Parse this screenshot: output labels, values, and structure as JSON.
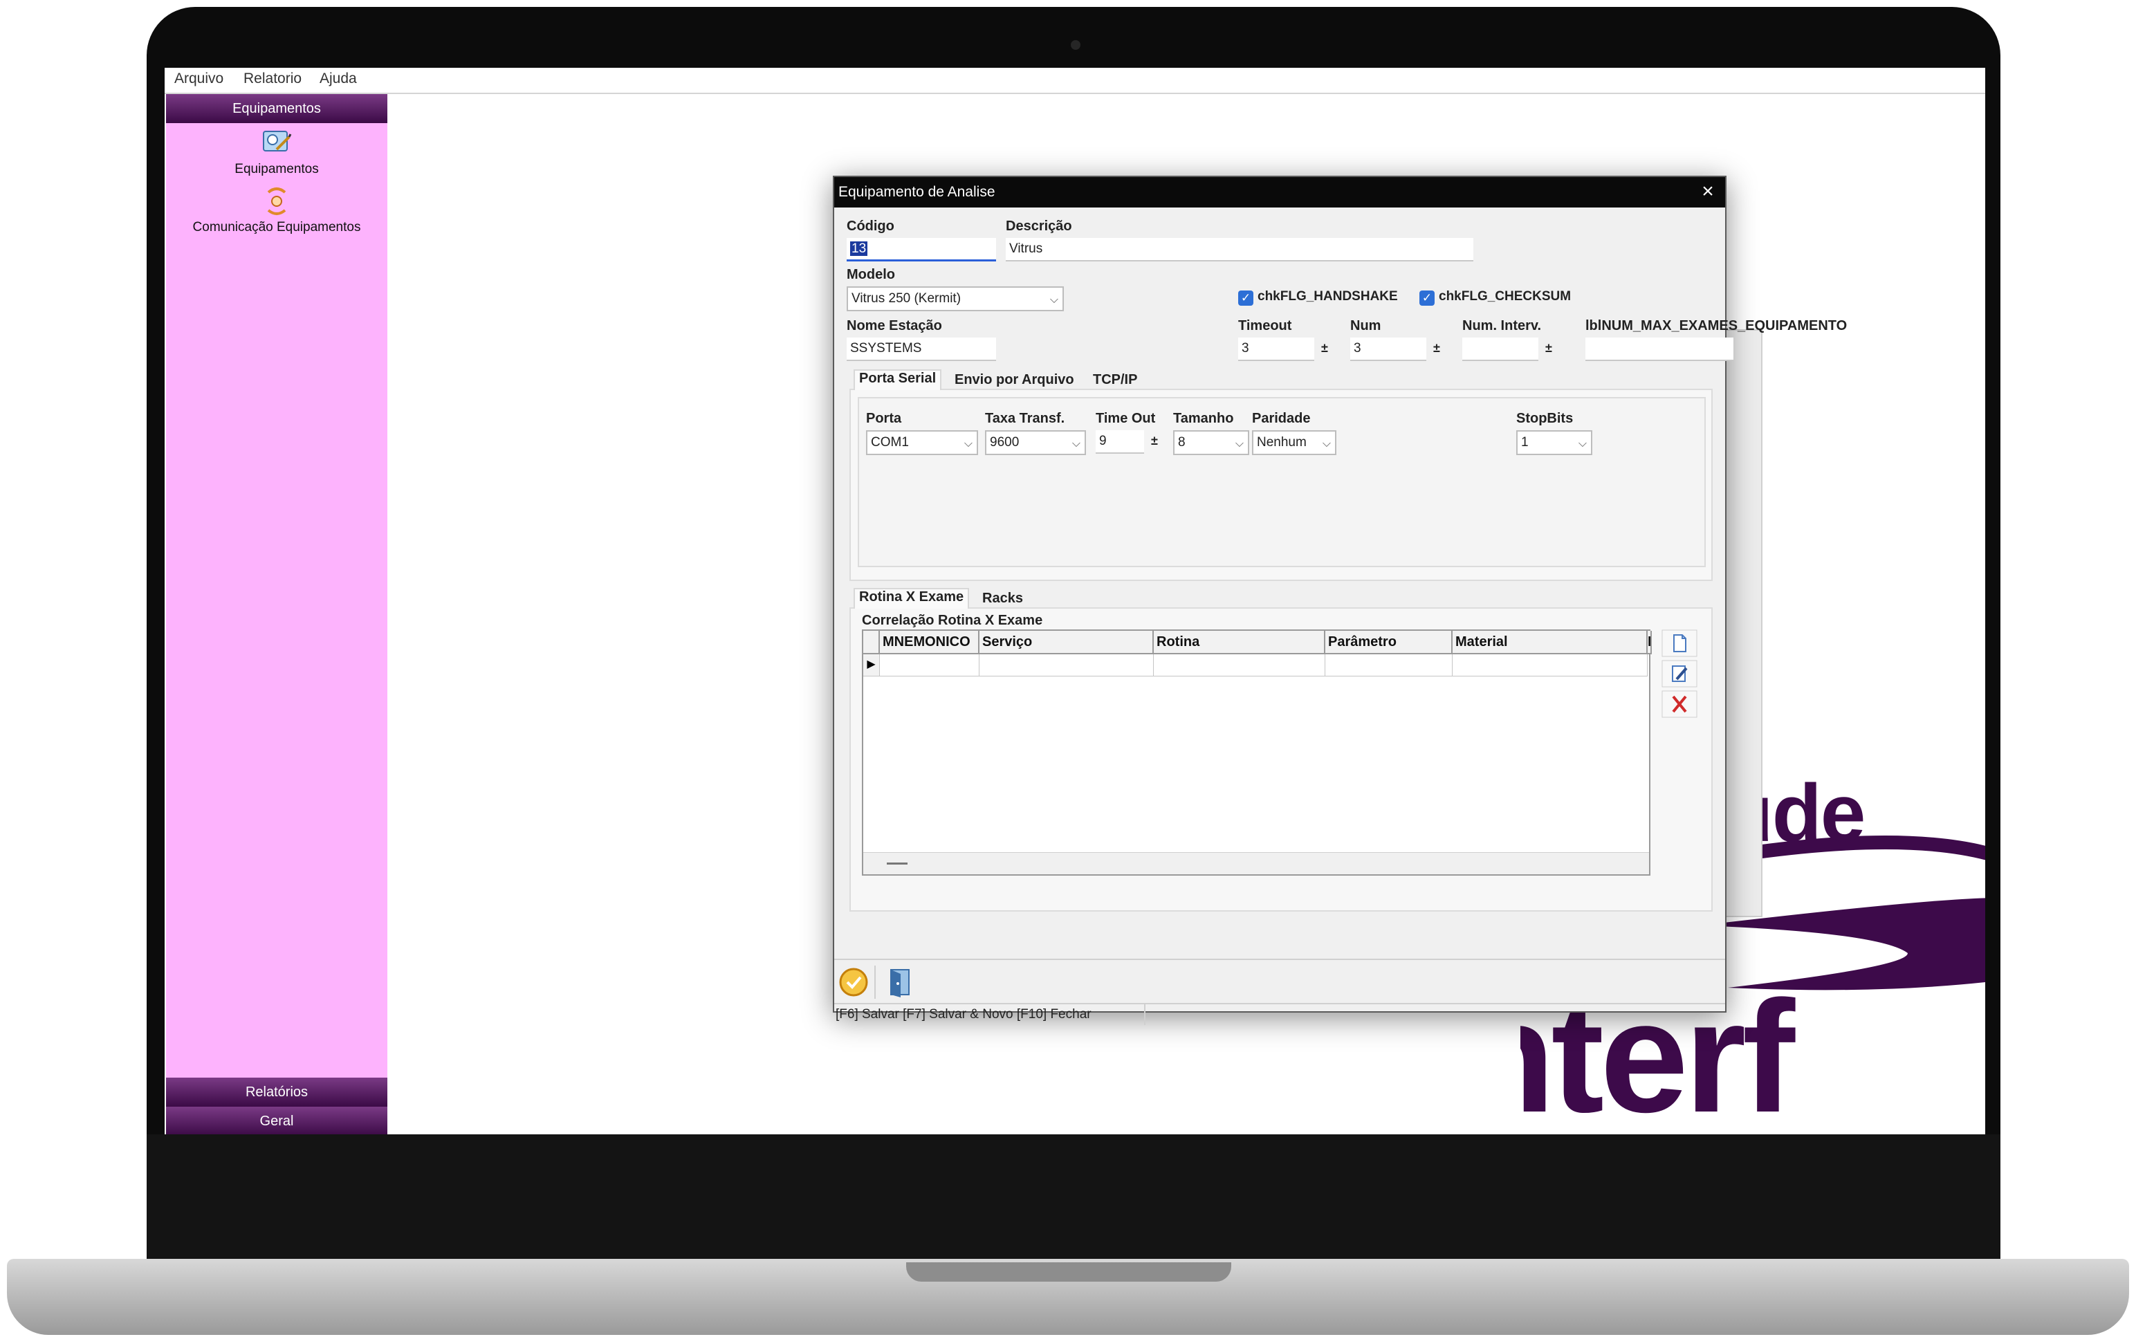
{
  "menu": [
    "Arquivo",
    "Relatorio",
    "Ajuda"
  ],
  "sidebar": {
    "header": "Equipamentos",
    "items": [
      {
        "label": "Equipamentos",
        "icon": "equipment-icon"
      },
      {
        "label": "Comunicação Equipamentos",
        "icon": "communication-icon"
      }
    ],
    "footer": [
      "Relatórios",
      "Geral"
    ],
    "color": "#fdb3fd"
  },
  "background_logo_text": [
    "aúde",
    "nterf"
  ],
  "dialog": {
    "title": "Equipamento de Analise",
    "codigo": {
      "label": "Código",
      "value": "13"
    },
    "descricao": {
      "label": "Descrição",
      "value": "Vitrus"
    },
    "modelo": {
      "label": "Modelo",
      "value": "Vitrus 250 (Kermit)"
    },
    "chk_handshake": "chkFLG_HANDSHAKE",
    "chk_checksum": "chkFLG_CHECKSUM",
    "nome_estacao": {
      "label": "Nome Estação",
      "value": "SSYSTEMS"
    },
    "timeout": {
      "label": "Timeout",
      "value": "3"
    },
    "num": {
      "label": "Num",
      "value": "3"
    },
    "num_interv": {
      "label": "Num. Interv.",
      "value": ""
    },
    "max_exames": {
      "label": "lblNUM_MAX_EXAMES_EQUIPAMENTO",
      "value": ""
    },
    "tabs": [
      "Porta Serial",
      "Envio por Arquivo",
      "TCP/IP"
    ],
    "serial": {
      "porta": {
        "label": "Porta",
        "value": "COM1"
      },
      "taxa": {
        "label": "Taxa Transf.",
        "value": "9600"
      },
      "timeout": {
        "label": "Time Out",
        "value": "9"
      },
      "tamanho": {
        "label": "Tamanho",
        "value": "8"
      },
      "paridade": {
        "label": "Paridade",
        "value": "Nenhum"
      },
      "stopbits": {
        "label": "StopBits",
        "value": "1"
      }
    },
    "tabs2": [
      "Rotina X Exame",
      "Racks"
    ],
    "group_title": "Correlação Rotina X Exame",
    "grid_columns": [
      "MNEMONICO",
      "Serviço",
      "Rotina",
      "Parâmetro",
      "Material",
      "I"
    ],
    "status": "[F6] Salvar [F7] Salvar & Novo [F10] Fechar"
  }
}
